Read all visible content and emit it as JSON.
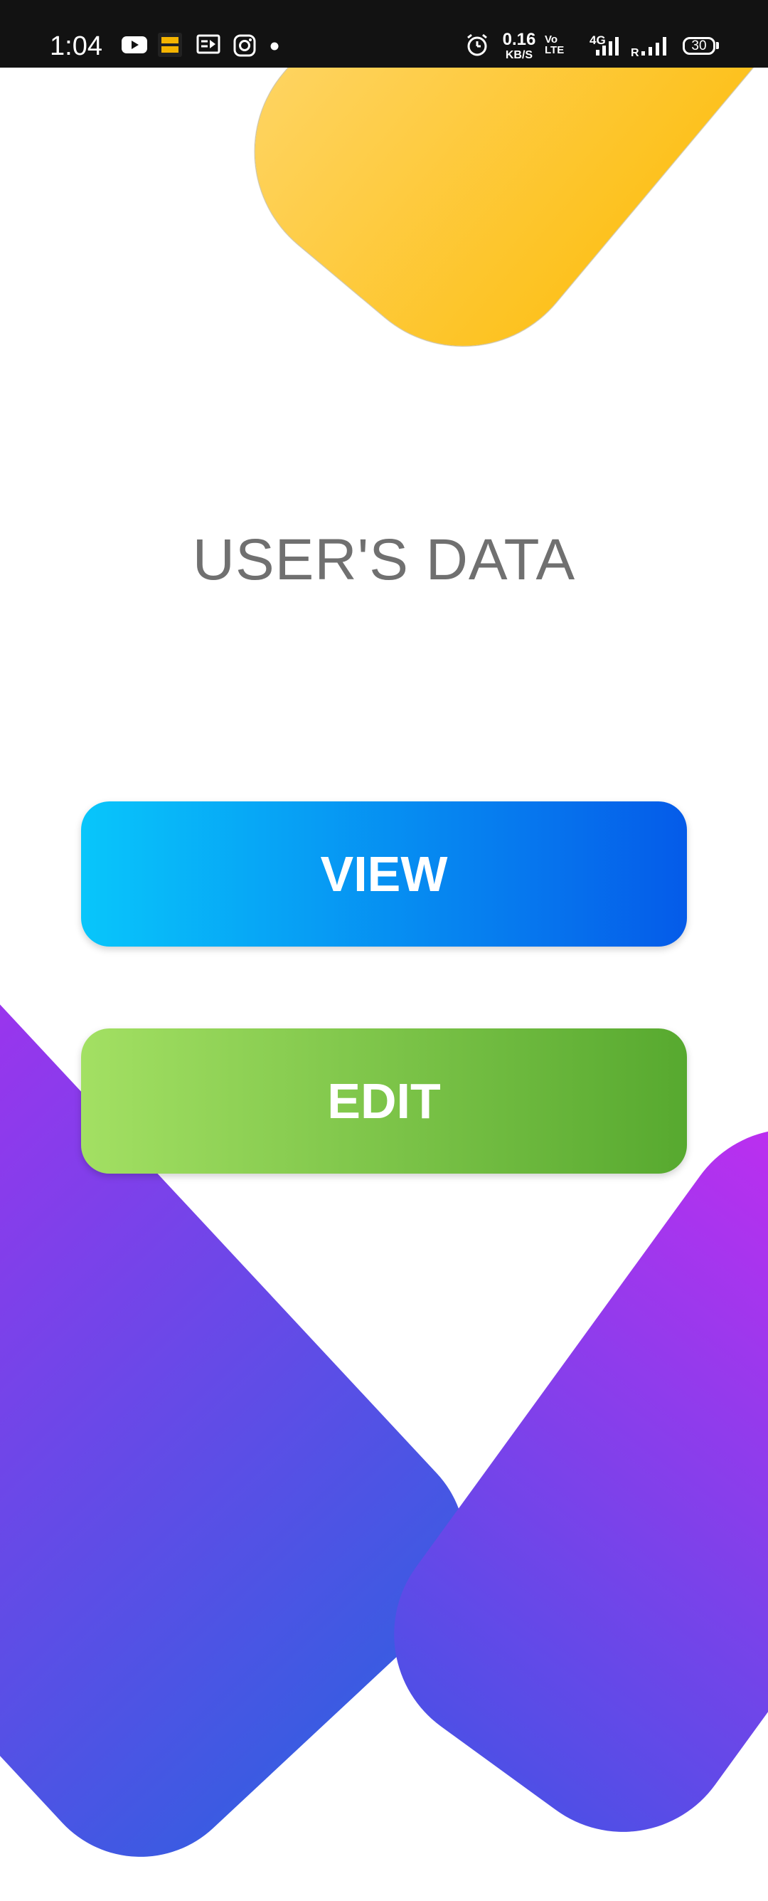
{
  "status_bar": {
    "time": "1:04",
    "speed_value": "0.16",
    "speed_unit": "KB/S",
    "volte_top": "Vo",
    "volte_bottom": "LTE",
    "network": "4G",
    "roaming": "R",
    "battery": "30"
  },
  "main": {
    "title": "USER'S DATA",
    "view_label": "VIEW",
    "edit_label": "EDIT"
  },
  "colors": {
    "yellow_shape": "#fdc21f",
    "view_start": "#08c6fb",
    "view_end": "#055be9",
    "edit_start": "#a3e063",
    "edit_end": "#57a92f",
    "purple": "#b02cf0",
    "blue": "#3b5be2"
  }
}
